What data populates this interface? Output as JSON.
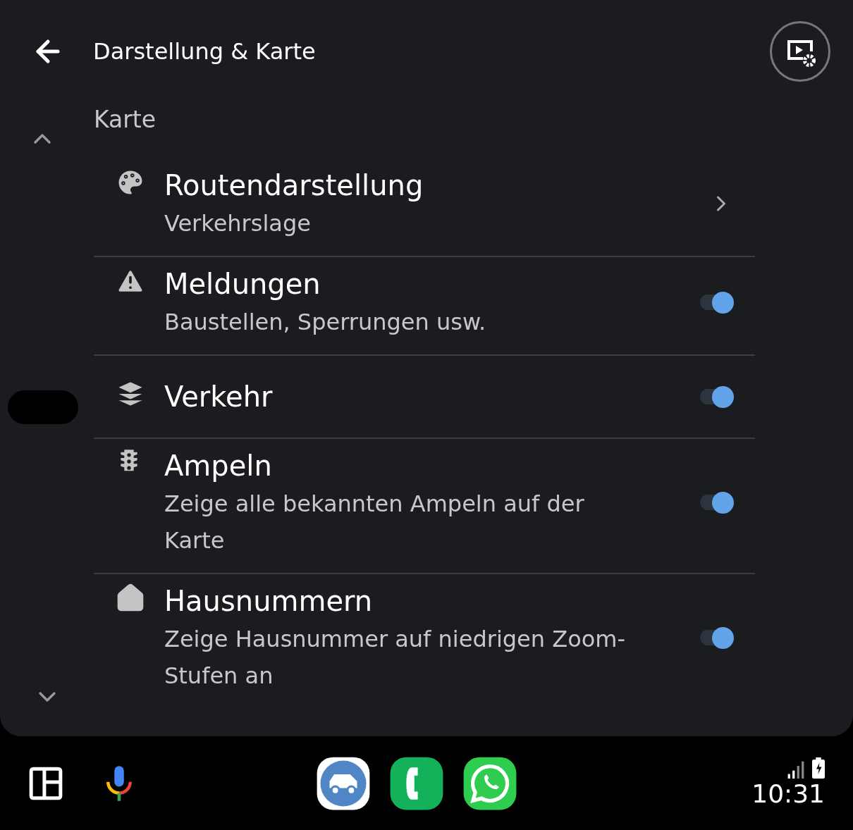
{
  "header": {
    "title": "Darstellung & Karte"
  },
  "section": {
    "title": "Karte"
  },
  "rows": [
    {
      "kind": "link",
      "title": "Routendarstellung",
      "subtitle": "Verkehrslage"
    },
    {
      "kind": "toggle",
      "title": "Meldungen",
      "subtitle": "Baustellen, Sperrungen usw.",
      "on": true
    },
    {
      "kind": "toggle",
      "title": "Verkehr",
      "on": true
    },
    {
      "kind": "toggle",
      "title": "Ampeln",
      "subtitle": "Zeige alle bekannten Ampeln auf der Karte",
      "on": true
    },
    {
      "kind": "toggle",
      "title": "Hausnummern",
      "subtitle": "Zeige Hausnummer auf niedrigen Zoom-Stufen an",
      "on": true
    }
  ],
  "status": {
    "time": "10:31"
  }
}
